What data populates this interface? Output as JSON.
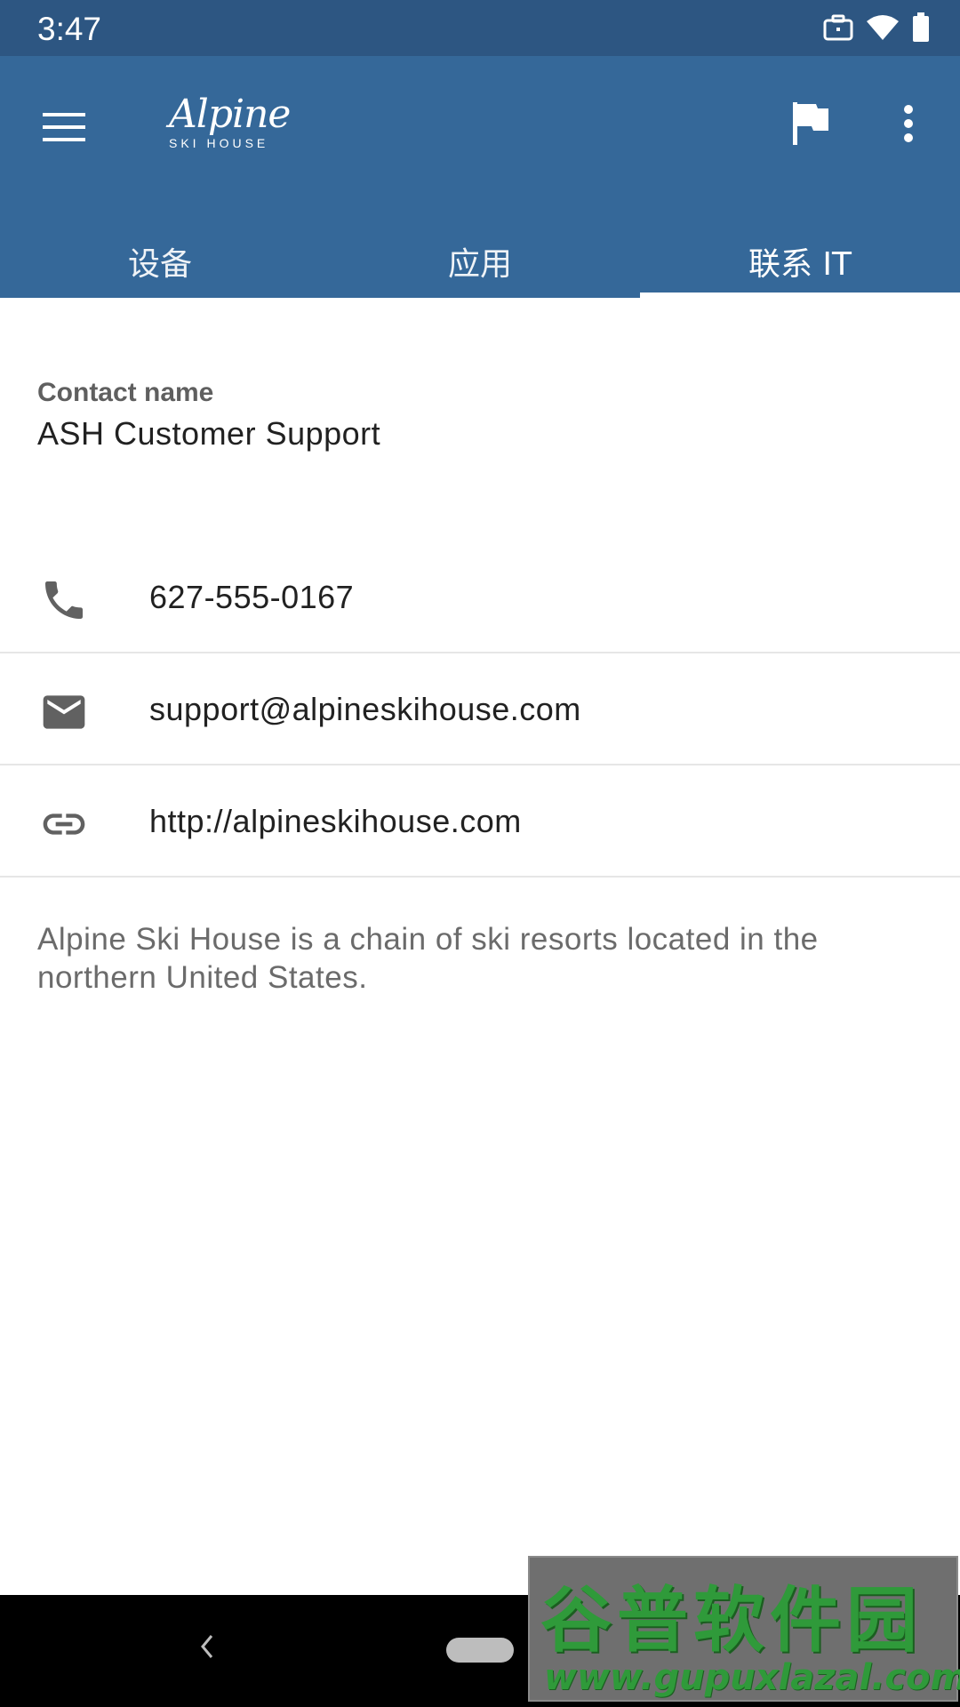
{
  "status_bar": {
    "time": "3:47",
    "icons": [
      "briefcase-icon",
      "wifi-icon",
      "battery-icon"
    ]
  },
  "app_bar": {
    "logo_main": "Alpine",
    "logo_sub": "SKI HOUSE",
    "menu_icon": "hamburger-menu-icon",
    "flag_icon": "flag-icon",
    "more_icon": "more-vertical-icon",
    "color": "#356899"
  },
  "tabs": [
    {
      "label": "设备",
      "active": false
    },
    {
      "label": "应用",
      "active": false
    },
    {
      "label": "联系 IT",
      "active": true
    }
  ],
  "contact": {
    "label": "Contact name",
    "name": "ASH Customer Support",
    "phone": "627-555-0167",
    "email": "support@alpineskihouse.com",
    "website": "http://alpineskihouse.com",
    "description": "Alpine Ski House is a chain of ski resorts located in the northern United States."
  },
  "watermark": {
    "title": "谷普软件园",
    "url": "www.gupuxlazal.com"
  }
}
